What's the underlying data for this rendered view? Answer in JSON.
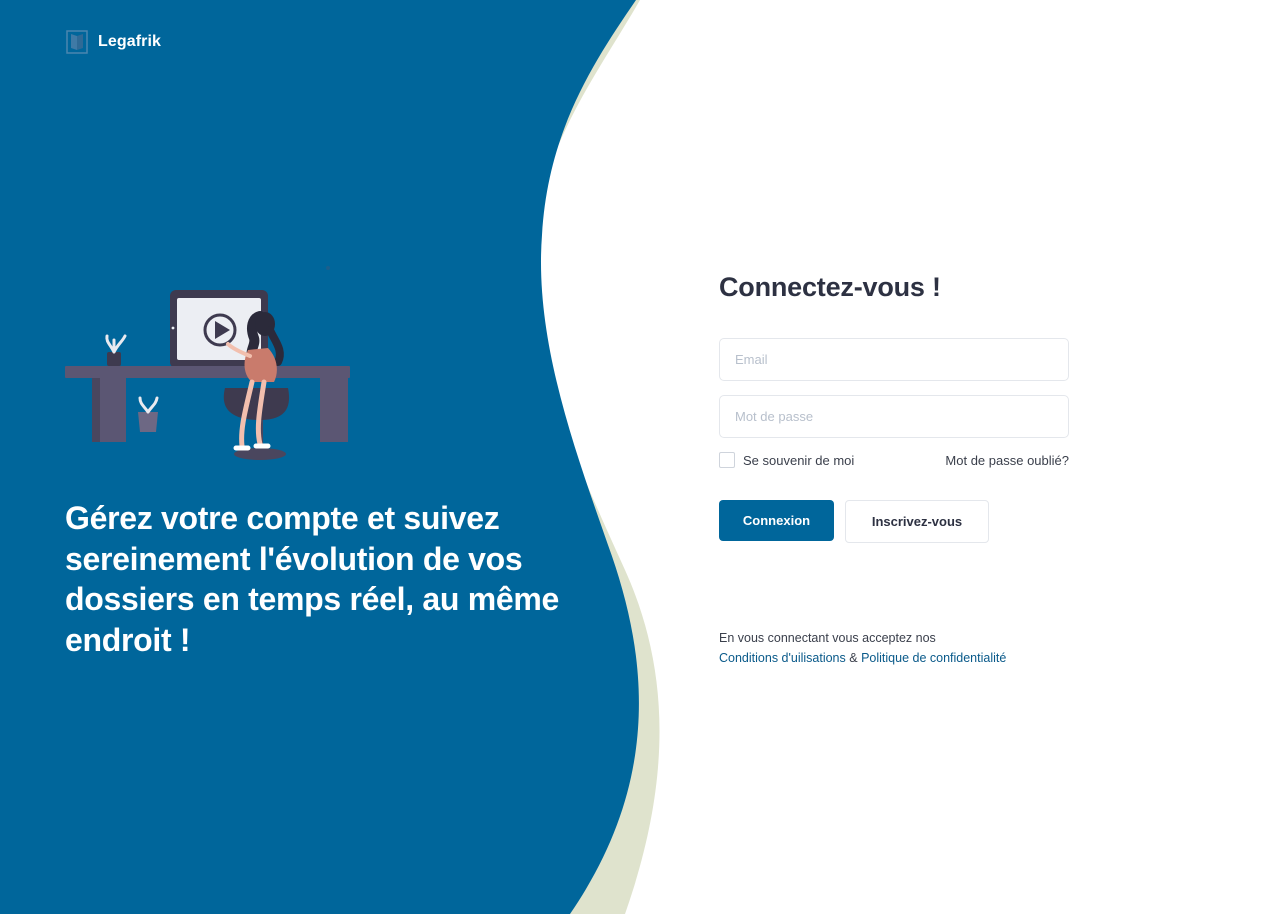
{
  "brand": {
    "name": "Legafrik",
    "logo_icon": "legafrik-logo-icon"
  },
  "colors": {
    "primary": "#00669b",
    "accent_curve": "#dfe3cd",
    "title": "#2d3142",
    "text": "#3a3f4b",
    "link": "#0a5a8a"
  },
  "illustration": {
    "icon": "woman-at-desk-video-illustration"
  },
  "hero": {
    "headline": "Gérez votre compte et suivez sereinement l'évolution de vos dossiers en temps réel, au même endroit !"
  },
  "login": {
    "title": "Connectez-vous !",
    "email_placeholder": "Email",
    "password_placeholder": "Mot de passe",
    "remember_label": "Se souvenir de moi",
    "forgot_label": "Mot de passe oublié?",
    "submit_label": "Connexion",
    "signup_label": "Inscrivez-vous",
    "legal_intro": "En vous connectant vous acceptez nos",
    "terms_label": "Conditions d'uilisations",
    "legal_and": "&",
    "privacy_label": "Politique de confidentialité"
  }
}
